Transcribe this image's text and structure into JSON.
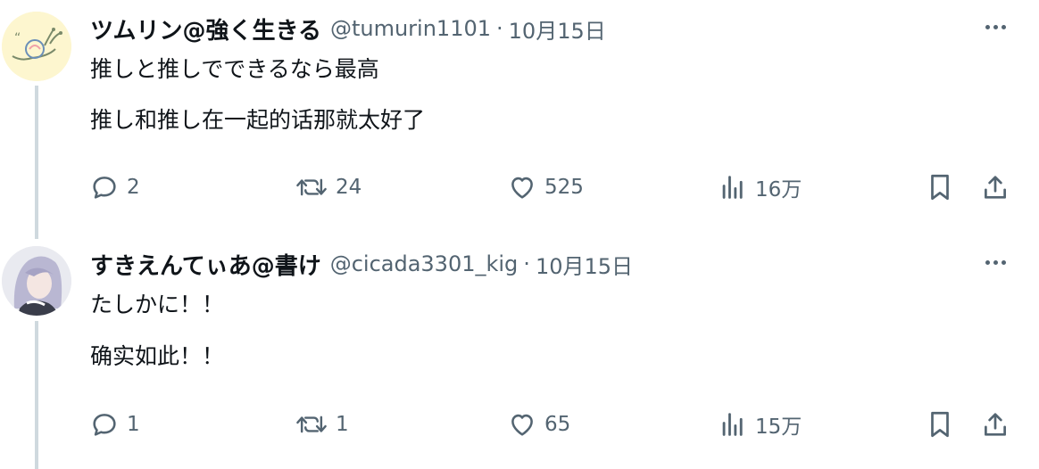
{
  "tweets": [
    {
      "display_name": "ツムリン@強く生きる",
      "handle": "@tumurin1101",
      "separator": "·",
      "date": "10月15日",
      "text": "推しと推しでできるなら最高",
      "translation": "推し和推し在一起的话那就太好了",
      "stats": {
        "replies": "2",
        "retweets": "24",
        "likes": "525",
        "views": "16万"
      }
    },
    {
      "display_name": "すきえんてぃあ@書け",
      "handle": "@cicada3301_kig",
      "separator": "·",
      "date": "10月15日",
      "text": "たしかに！！",
      "translation": "确实如此！！",
      "stats": {
        "replies": "1",
        "retweets": "1",
        "likes": "65",
        "views": "15万"
      }
    }
  ],
  "colors": {
    "text_primary": "#0f1419",
    "text_secondary": "#536471",
    "thread_line": "#cfd9de",
    "background": "#ffffff"
  },
  "icons": [
    "reply-icon",
    "retweet-icon",
    "like-icon",
    "views-icon",
    "bookmark-icon",
    "share-icon",
    "more-icon"
  ]
}
